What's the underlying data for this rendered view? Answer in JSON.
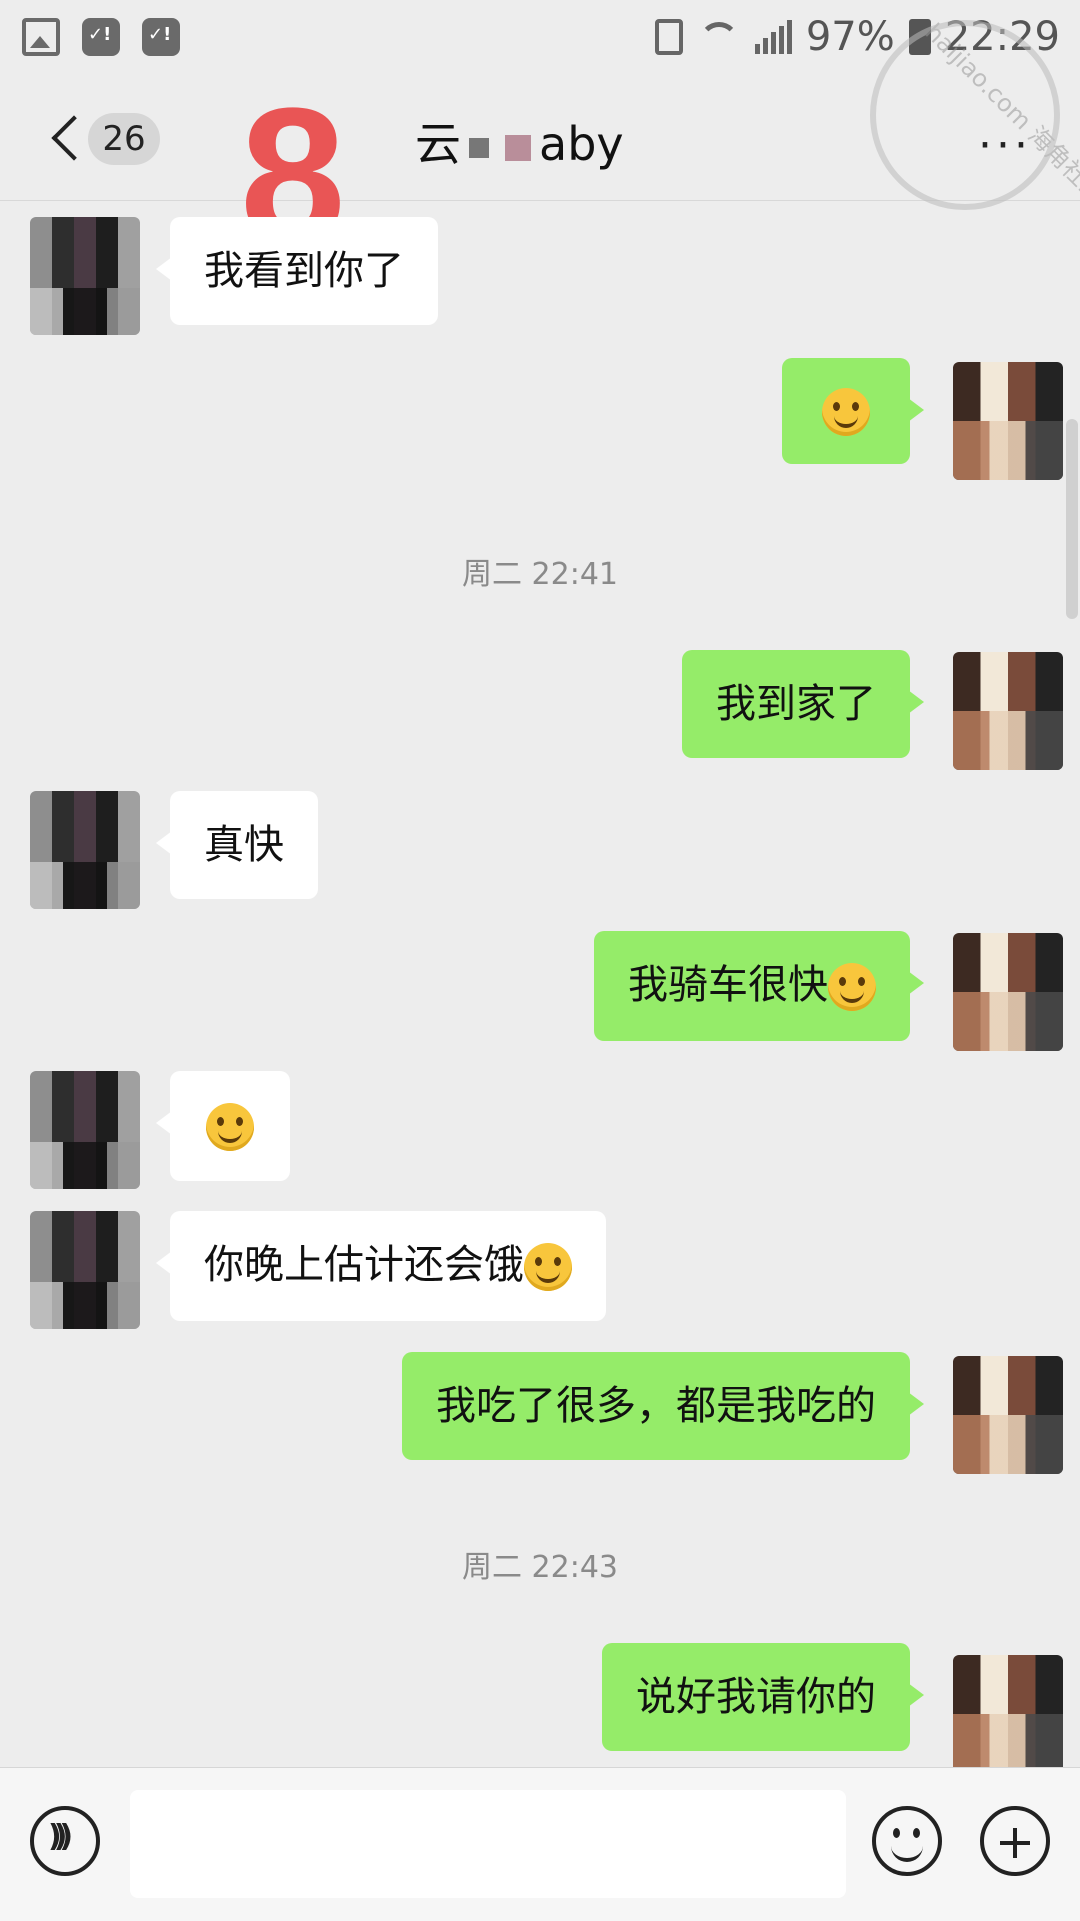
{
  "status_bar": {
    "battery_percent": "97%",
    "time": "22:29"
  },
  "nav": {
    "unread_count": "26",
    "overlay_number": "8",
    "contact_name_prefix": "云",
    "contact_name_suffix": "aby",
    "more_label": "···",
    "watermark": "haijiao.com 海角社区"
  },
  "messages": [
    {
      "side": "left",
      "text": "我看到你了"
    },
    {
      "side": "right",
      "text": "",
      "emoji": "grin-emoji"
    },
    {
      "type": "time",
      "text": "周二 22:41"
    },
    {
      "side": "right",
      "text": "我到家了"
    },
    {
      "side": "left",
      "text": "真快"
    },
    {
      "side": "right",
      "text": "我骑车很快",
      "emoji": "smug-emoji"
    },
    {
      "side": "left",
      "text": "",
      "emoji": "thinking-emoji"
    },
    {
      "side": "left",
      "text": "你晚上估计还会饿",
      "emoji": "crying-laugh-emoji"
    },
    {
      "side": "right",
      "text": "我吃了很多，都是我吃的"
    },
    {
      "type": "time",
      "text": "周二 22:43"
    },
    {
      "side": "right",
      "text": "说好我请你的"
    }
  ],
  "input": {
    "placeholder": ""
  }
}
